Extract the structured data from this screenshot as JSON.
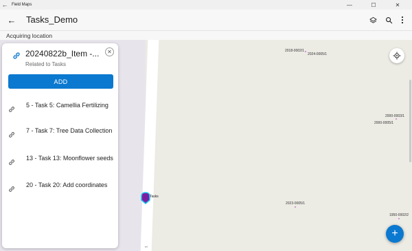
{
  "window": {
    "title": "Field Maps",
    "minimize_glyph": "—",
    "maximize_glyph": "☐",
    "close_glyph": "✕",
    "back_glyph": "←"
  },
  "appbar": {
    "back_glyph": "←",
    "title": "Tasks_Demo",
    "icons": [
      "layers-icon",
      "search-icon",
      "more-vert-icon"
    ]
  },
  "status": {
    "text": "Acquiring location"
  },
  "panel": {
    "title": "20240822b_Item -...",
    "subtitle": "Related to Tasks",
    "close_glyph": "✕",
    "add_label": "ADD",
    "items": [
      {
        "label": "5 - Task 5: Camellia Fertilizing"
      },
      {
        "label": "7 - Task 7: Tree Data Collection"
      },
      {
        "label": "13 - Task 13: Moonflower seeds"
      },
      {
        "label": "20 - Task 20: Add coordinates"
      }
    ]
  },
  "map": {
    "parcels": [
      {
        "label": "2018-0002/1"
      },
      {
        "label": "2024-0005/1"
      },
      {
        "label": "2000-0003/1"
      },
      {
        "label": "2000-0005/1"
      },
      {
        "label": "2023-0005/1"
      },
      {
        "label": "1950-0002/2"
      }
    ],
    "pin_label": "Tasks",
    "road_label": "rd",
    "fab_glyph": "+",
    "colors": {
      "accent": "#0b79d0",
      "pin": "#7a1ea1",
      "pin_halo": "#1ec8f0"
    }
  }
}
